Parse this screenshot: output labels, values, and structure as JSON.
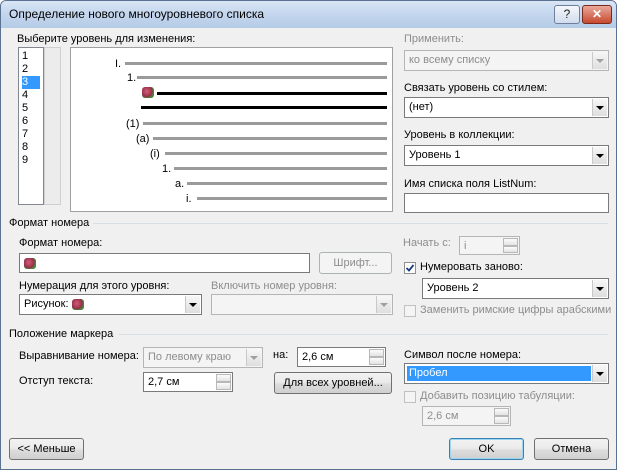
{
  "window": {
    "title": "Определение нового многоуровневого списка",
    "help_label": "?",
    "close_label": "✕"
  },
  "levels": {
    "label": "Выберите уровень для изменения:",
    "items": [
      "1",
      "2",
      "3",
      "4",
      "5",
      "6",
      "7",
      "8",
      "9"
    ],
    "selected": "3"
  },
  "preview": {
    "markers": [
      "I.",
      "1.",
      "",
      "",
      "(1)",
      "(a)",
      "(i)",
      "1.",
      "a.",
      "i."
    ]
  },
  "apply": {
    "label": "Применить:",
    "value": "ко всему списку"
  },
  "link_style": {
    "label": "Связать уровень со стилем:",
    "value": "(нет)"
  },
  "gallery_level": {
    "label": "Уровень в коллекции:",
    "value": "Уровень 1"
  },
  "listnum": {
    "label": "Имя списка поля ListNum:",
    "value": ""
  },
  "number_format": {
    "section": "Формат номера",
    "label": "Формат номера:",
    "font_button": "Шрифт...",
    "start_label": "Начать с:",
    "start_value": "i",
    "style_label": "Нумерация для этого уровня:",
    "style_value": "Рисунок:",
    "include_label": "Включить номер уровня:",
    "include_value": "",
    "restart_label": "Нумеровать заново:",
    "restart_checked": true,
    "restart_value": "Уровень 2",
    "legal_label": "Заменить римские цифры арабскими",
    "legal_checked": false
  },
  "position": {
    "section": "Положение маркера",
    "align_label": "Выравнивание номера:",
    "align_value": "По левому краю",
    "at_label": "на:",
    "at_value": "2,6 см",
    "indent_label": "Отступ текста:",
    "indent_value": "2,7 см",
    "all_levels_button": "Для всех уровней...",
    "follow_label": "Символ после номера:",
    "follow_value": "Пробел",
    "tab_label": "Добавить позицию табуляции:",
    "tab_checked": false,
    "tab_value": "2,6 см"
  },
  "buttons": {
    "less": "<< Меньше",
    "ok": "OK",
    "cancel": "Отмена"
  }
}
